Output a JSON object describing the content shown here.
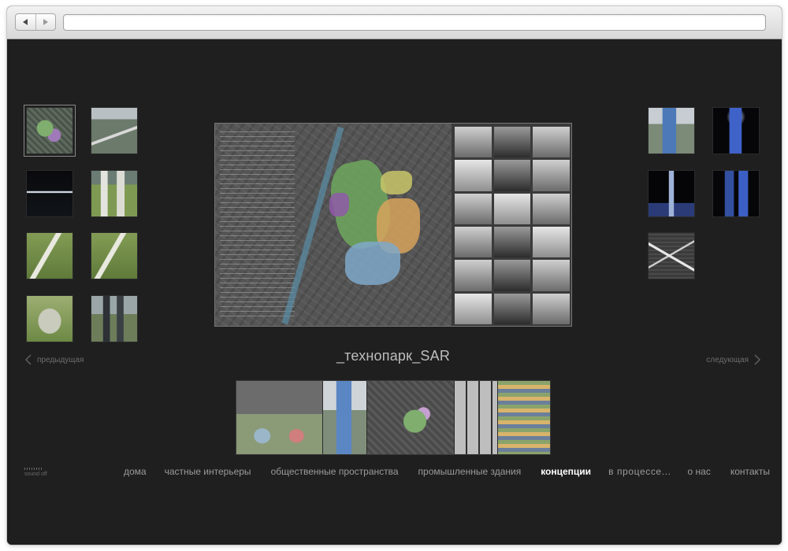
{
  "browser": {
    "back_icon": "back-arrow-icon",
    "forward_icon": "forward-arrow-icon",
    "url": ""
  },
  "gallery": {
    "title": "_технопарк_SAR",
    "prev_label": "предыдущая",
    "next_label": "следующая",
    "left_thumbnails": [
      {
        "scene": "site-plan",
        "selected": true
      },
      {
        "scene": "aerial-render"
      },
      {
        "scene": "night-section"
      },
      {
        "scene": "block-render"
      },
      {
        "scene": "green-render"
      },
      {
        "scene": "courtyard-render"
      },
      {
        "scene": "park-render"
      },
      {
        "scene": "towers-render"
      }
    ],
    "right_thumbnails": [
      {
        "scene": "glass-tower"
      },
      {
        "scene": "night-tower"
      },
      {
        "scene": "light-beam"
      },
      {
        "scene": "twin-towers"
      },
      {
        "scene": "map-sketch"
      }
    ],
    "filmstrip": [
      {
        "scene": "render-sheet"
      },
      {
        "scene": "tower-render"
      },
      {
        "scene": "site-plan"
      },
      {
        "scene": "photo-sheet"
      },
      {
        "scene": "zoning-sheet"
      }
    ]
  },
  "sound": {
    "label": "sound off"
  },
  "menu": {
    "items": [
      {
        "label": "дома"
      },
      {
        "label": "частные интерьеры"
      },
      {
        "label": "общественные пространства"
      },
      {
        "label": "промышленные здания"
      },
      {
        "label": "концепции",
        "active": true
      },
      {
        "label": "в процессе..."
      },
      {
        "label": "о нас"
      },
      {
        "label": "контакты"
      }
    ]
  },
  "colors": {
    "background": "#1f1f1f",
    "menu_text": "#9b9b9b",
    "menu_active": "#ffffff",
    "title_text": "#bdbdbd"
  }
}
